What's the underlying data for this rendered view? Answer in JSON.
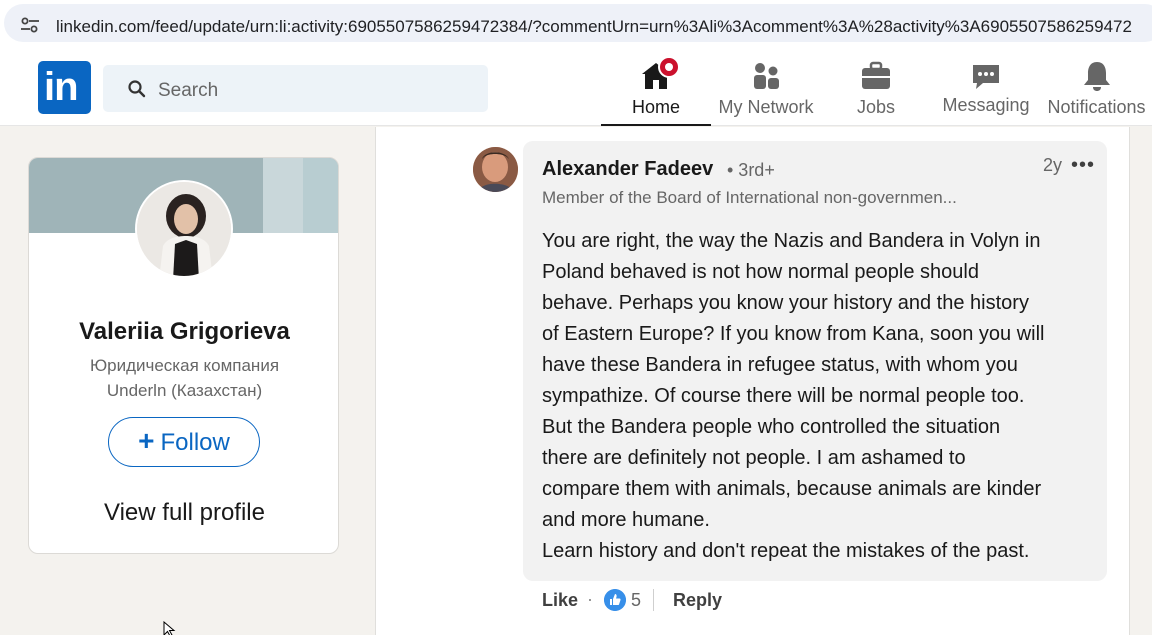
{
  "browser": {
    "url": "linkedin.com/feed/update/urn:li:activity:6905507586259472384/?commentUrn=urn%3Ali%3Acomment%3A%28activity%3A6905507586259472"
  },
  "header": {
    "logo_text": "in",
    "search_placeholder": "Search",
    "nav": [
      {
        "label": "Home",
        "icon": "home-icon",
        "active": true
      },
      {
        "label": "My Network",
        "icon": "network-icon"
      },
      {
        "label": "Jobs",
        "icon": "briefcase-icon"
      },
      {
        "label": "Messaging",
        "icon": "messaging-icon"
      },
      {
        "label": "Notifications",
        "icon": "bell-icon"
      }
    ]
  },
  "profile_card": {
    "name": "Valeriia Grigorieva",
    "company_line1": "Юридическая компания",
    "company_line2": "Underln (Казахстан)",
    "follow_label": "Follow",
    "view_profile_label": "View full profile"
  },
  "comment": {
    "author": "Alexander Fadeev",
    "degree": "• 3rd+",
    "age": "2y",
    "more": "•••",
    "headline": "Member of the Board of International non-governmen...",
    "body_lines": [
      "You are right, the way the Nazis and Bandera in Volyn in",
      "Poland behaved is not how normal people should",
      "behave. Perhaps you know your history and the history",
      "of Eastern Europe? If you know from Kana, soon you will",
      "have these Bandera in refugee status, with whom you",
      "sympathize. Of course there will be normal people too.",
      "But the Bandera people who controlled the situation",
      "there are definitely not people. I am ashamed to",
      "compare them with animals, because animals are kinder",
      "and more humane.",
      "Learn history and don't repeat the mistakes of the past."
    ],
    "like_label": "Like",
    "separator": "·",
    "reaction_count": "5",
    "reply_label": "Reply"
  },
  "colors": {
    "linkedin_blue": "#0a66c2",
    "badge_red": "#cb112d",
    "page_bg": "#f4f2ee"
  }
}
